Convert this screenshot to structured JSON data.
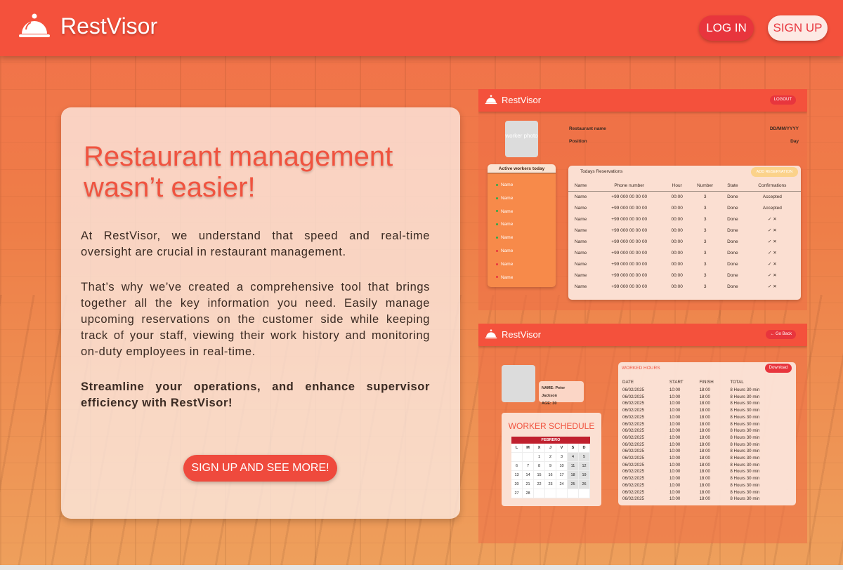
{
  "header": {
    "brand": "RestVisor",
    "login_label": "LOG IN",
    "signup_label": "SIGN UP"
  },
  "hero": {
    "title": "Restaurant management wasn’t easier!",
    "para1": "At RestVisor, we understand that speed and real-time oversight are crucial in restaurant management.",
    "para2": "That’s why we’ve created a comprehensive tool that brings together all the key information you need. Easily manage upcoming reservations on the customer side while keeping track of your staff, viewing their work history and monitoring on-duty employees in real-time.",
    "para3": "Streamline your operations, and enhance supervisor efficiency with RestVisor!",
    "cta_label": "SIGN UP AND SEE MORE!"
  },
  "preview_dashboard": {
    "brand": "RestVisor",
    "logout_label": "LOGOUT",
    "photo_label": "worker photo",
    "restaurant_name_label": "Restaurant name",
    "position_label": "Position",
    "date_label": "DD/MM/YYYY",
    "day_label": "Day",
    "active_title": "Active workers today",
    "workers": [
      {
        "name": "Name",
        "status": "active"
      },
      {
        "name": "Name",
        "status": "active"
      },
      {
        "name": "Name",
        "status": "active"
      },
      {
        "name": "Name",
        "status": "active"
      },
      {
        "name": "Name",
        "status": "active"
      },
      {
        "name": "Name",
        "status": "inactive"
      },
      {
        "name": "Name",
        "status": "inactive"
      },
      {
        "name": "Name",
        "status": "inactive"
      }
    ],
    "reservations_title": "Todays Reservations",
    "add_reservation_label": "ADD RESERVATION",
    "columns": [
      "Name",
      "Phone number",
      "Hour",
      "Number",
      "State",
      "Confirmations"
    ],
    "rows": [
      {
        "name": "Name",
        "phone": "+99 000 00 00 00",
        "hour": "00:00",
        "number": "3",
        "state": "Done",
        "confirmation": "Accepted"
      },
      {
        "name": "Name",
        "phone": "+99 000 00 00 00",
        "hour": "00:00",
        "number": "3",
        "state": "Done",
        "confirmation": "Accepted"
      },
      {
        "name": "Name",
        "phone": "+99 000 00 00 00",
        "hour": "00:00",
        "number": "3",
        "state": "Done",
        "confirmation": "✓ ✕"
      },
      {
        "name": "Name",
        "phone": "+99 000 00 00 00",
        "hour": "00:00",
        "number": "3",
        "state": "Done",
        "confirmation": "✓ ✕"
      },
      {
        "name": "Name",
        "phone": "+99 000 00 00 00",
        "hour": "00:00",
        "number": "3",
        "state": "Done",
        "confirmation": "✓ ✕"
      },
      {
        "name": "Name",
        "phone": "+99 000 00 00 00",
        "hour": "00:00",
        "number": "3",
        "state": "Done",
        "confirmation": "✓ ✕"
      },
      {
        "name": "Name",
        "phone": "+99 000 00 00 00",
        "hour": "00:00",
        "number": "3",
        "state": "Done",
        "confirmation": "✓ ✕"
      },
      {
        "name": "Name",
        "phone": "+99 000 00 00 00",
        "hour": "00:00",
        "number": "3",
        "state": "Done",
        "confirmation": "✓ ✕"
      },
      {
        "name": "Name",
        "phone": "+99 000 00 00 00",
        "hour": "00:00",
        "number": "3",
        "state": "Done",
        "confirmation": "✓ ✕"
      }
    ]
  },
  "preview_worker": {
    "brand": "RestVisor",
    "back_label": "← Go Back",
    "name_line": "NAME: Peter Jackson",
    "age_line": "AGE: 30",
    "schedule_title": "WORKER SCHEDULE",
    "month": "FEBRERO",
    "weekdays": [
      "L",
      "M",
      "X",
      "J",
      "V",
      "S",
      "D"
    ],
    "calendar_cells": [
      "",
      "",
      "1",
      "2",
      "3",
      "4",
      "5",
      "6",
      "7",
      "8",
      "9",
      "10",
      "11",
      "12",
      "13",
      "14",
      "15",
      "16",
      "17",
      "18",
      "19",
      "20",
      "21",
      "22",
      "23",
      "24",
      "25",
      "26",
      "27",
      "28",
      "",
      "",
      "",
      "",
      ""
    ],
    "hours_title": "WORKED HOURS",
    "download_label": "Download",
    "hours_columns": [
      "DATE",
      "START",
      "FINISH",
      "TOTAL"
    ],
    "hours_rows": [
      [
        "06/02/2025",
        "10:00",
        "18:00",
        "8 Hours 30 min"
      ],
      [
        "06/02/2025",
        "10:00",
        "18:00",
        "8 Hours 30 min"
      ],
      [
        "06/02/2025",
        "10:00",
        "18:00",
        "8 Hours 30 min"
      ],
      [
        "06/02/2025",
        "10:00",
        "18:00",
        "8 Hours 30 min"
      ],
      [
        "06/02/2025",
        "10:00",
        "18:00",
        "8 Hours 30 min"
      ],
      [
        "06/02/2025",
        "10:00",
        "18:00",
        "8 Hours 30 min"
      ],
      [
        "06/02/2025",
        "10:00",
        "18:00",
        "8 Hours 30 min"
      ],
      [
        "06/02/2025",
        "10:00",
        "18:00",
        "8 Hours 30 min"
      ],
      [
        "06/02/2025",
        "10:00",
        "18:00",
        "8 Hours 30 min"
      ],
      [
        "06/02/2025",
        "10:00",
        "18:00",
        "8 Hours 30 min"
      ],
      [
        "06/02/2025",
        "10:00",
        "18:00",
        "8 Hours 30 min"
      ],
      [
        "06/02/2025",
        "10:00",
        "18:00",
        "8 Hours 30 min"
      ],
      [
        "06/02/2025",
        "10:00",
        "18:00",
        "8 Hours 30 min"
      ],
      [
        "06/02/2025",
        "10:00",
        "18:00",
        "8 Hours 30 min"
      ],
      [
        "06/02/2025",
        "10:00",
        "18:00",
        "8 Hours 30 min"
      ],
      [
        "06/02/2025",
        "10:00",
        "18:00",
        "8 Hours 30 min"
      ],
      [
        "06/02/2025",
        "10:00",
        "18:00",
        "8 Hours 30 min"
      ]
    ]
  },
  "colors": {
    "header": "#f4513c",
    "accent": "#e8353d",
    "title": "#f0533f",
    "active_dot": "#2ea84a",
    "inactive_dot": "#e8353d"
  }
}
